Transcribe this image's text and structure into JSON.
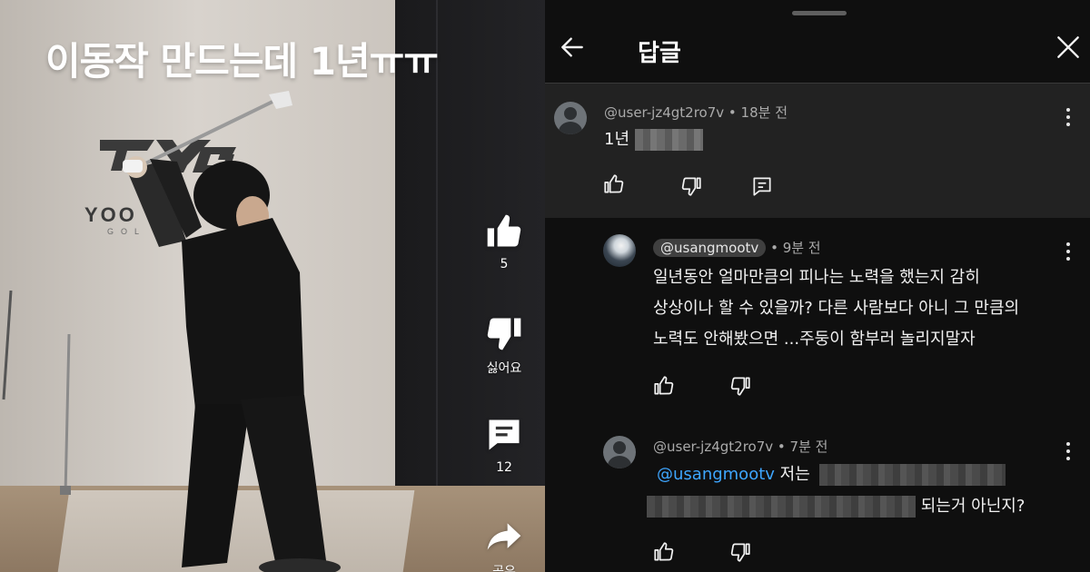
{
  "video": {
    "overlay_title": "이동작 만드는데 1년ㅠㅠ",
    "logo_wordmark": "YOO",
    "logo_sub": "GOL"
  },
  "actions": {
    "like_count": "5",
    "dislike_label": "싫어요",
    "comment_count": "12",
    "share_label": "공유"
  },
  "panel": {
    "title": "답글",
    "parent_comment": {
      "author": "@user-jz4gt2ro7v",
      "time": "18분 전",
      "text_prefix": "1년"
    },
    "replies": [
      {
        "author": "@usangmootv",
        "time": "9분 전",
        "lines": [
          "일년동안 얼마만큼의 피나는 노력을 했는지 감히",
          "상상이나 할 수 있을까? 다른 사람보다 아니 그 만큼의",
          "노력도 안해봤으면 ...주둥이 함부러 놀리지말자"
        ]
      },
      {
        "author": "@user-jz4gt2ro7v",
        "time": "7분 전",
        "mention": "@usangmootv",
        "text_after_mention": "저는",
        "text_end": "되는거 아닌지?"
      }
    ]
  },
  "colors": {
    "mention": "#3ea6ff",
    "panel_bg": "#0f0f0f",
    "highlighted_comment_bg": "#222222"
  }
}
